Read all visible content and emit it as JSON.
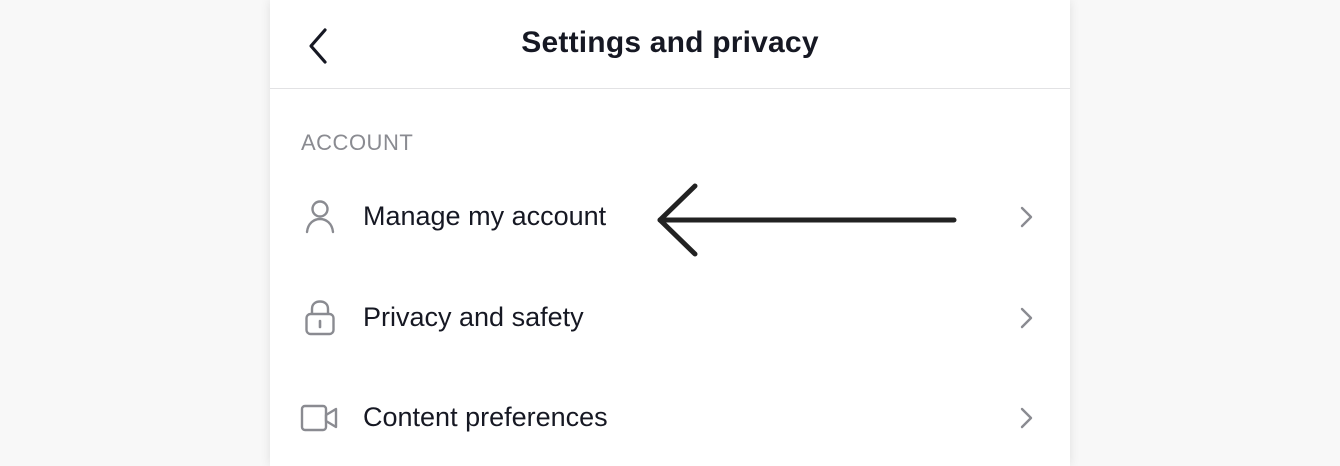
{
  "header": {
    "title": "Settings and privacy"
  },
  "sections": [
    {
      "label": "ACCOUNT",
      "items": [
        {
          "label": "Manage my account",
          "icon": "person-icon"
        },
        {
          "label": "Privacy and safety",
          "icon": "lock-icon"
        },
        {
          "label": "Content preferences",
          "icon": "video-camera-icon"
        }
      ]
    }
  ],
  "colors": {
    "background": "#f8f8f8",
    "panel": "#ffffff",
    "text": "#161823",
    "muted": "#8a8b91",
    "icon": "#8a8b91",
    "divider": "#e2e2e4"
  }
}
